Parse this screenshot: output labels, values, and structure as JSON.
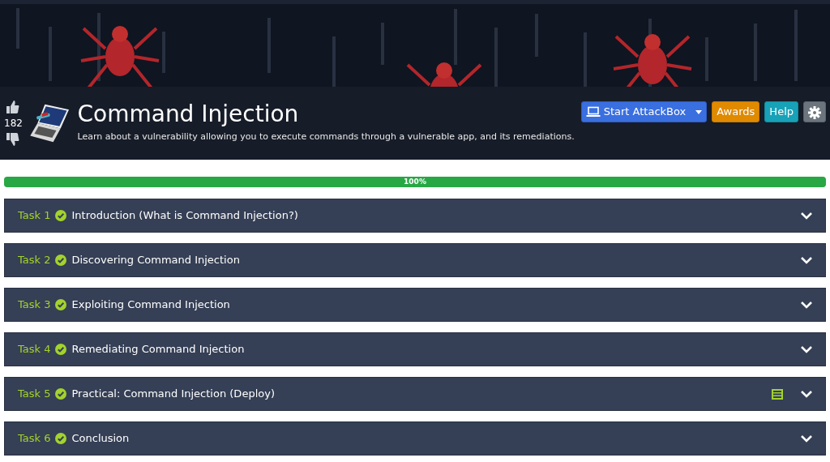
{
  "room": {
    "title": "Command Injection",
    "description": "Learn about a vulnerability allowing you to execute commands through a vulnerable app, and its remediations.",
    "votes": "182"
  },
  "buttons": [
    {
      "kind": "attackbox",
      "label": "Start AttackBox"
    },
    {
      "kind": "awards",
      "label": "Awards"
    },
    {
      "kind": "help",
      "label": "Help"
    },
    {
      "kind": "settings"
    }
  ],
  "progress": {
    "level": 1,
    "label": "100%"
  },
  "tasks": [
    {
      "number": "Task 1",
      "title": "Introduction (What is Command Injection?)",
      "completed": true,
      "machine": false,
      "expanded": false
    },
    {
      "number": "Task 2",
      "title": "Discovering Command Injection",
      "completed": true,
      "machine": false,
      "expanded": false
    },
    {
      "number": "Task 3",
      "title": "Exploiting Command Injection",
      "completed": true,
      "machine": false,
      "expanded": false
    },
    {
      "number": "Task 4",
      "title": "Remediating Command Injection",
      "completed": true,
      "machine": false,
      "expanded": false
    },
    {
      "number": "Task 5",
      "title": "Practical: Command Injection (Deploy)",
      "completed": true,
      "machine": true,
      "expanded": false
    },
    {
      "number": "Task 6",
      "title": "Conclusion",
      "completed": true,
      "machine": false,
      "expanded": false
    }
  ]
}
